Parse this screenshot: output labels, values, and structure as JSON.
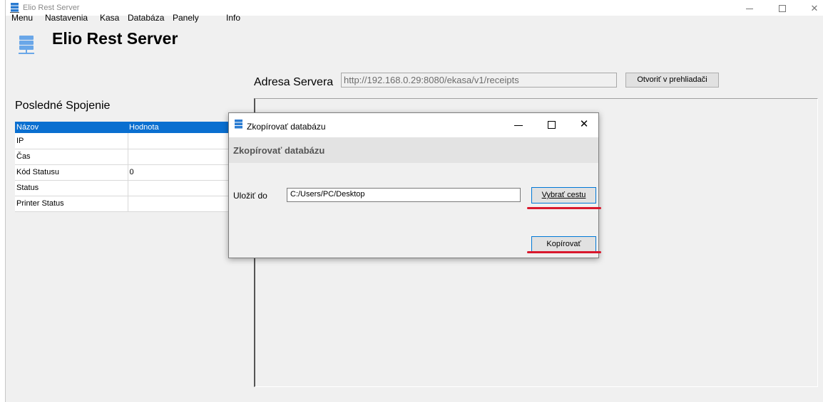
{
  "window": {
    "title": "Elio Rest Server"
  },
  "menu": [
    {
      "label": "Menu"
    },
    {
      "label": "Nastavenia"
    },
    {
      "label": "Kasa"
    },
    {
      "label": "Databáza"
    },
    {
      "label": "Panely"
    },
    {
      "label": "Info"
    }
  ],
  "header": {
    "app_title": "Elio Rest Server"
  },
  "address": {
    "label": "Adresa Servera",
    "value": "http://192.168.0.29:8080/ekasa/v1/receipts",
    "open_button": "Otvoriť v prehliadači"
  },
  "last_connection": {
    "title": "Posledné Spojenie",
    "columns": [
      "Názov",
      "Hodnota"
    ],
    "rows": [
      {
        "name": "IP",
        "value": ""
      },
      {
        "name": "Čas",
        "value": ""
      },
      {
        "name": "Kód Statusu",
        "value": "0"
      },
      {
        "name": "Status",
        "value": ""
      },
      {
        "name": "Printer Status",
        "value": ""
      }
    ]
  },
  "dialog": {
    "title": "Zkopírovať databázu",
    "header": "Zkopírovať databázu",
    "save_label": "Uložiť do",
    "path_value": "C:/Users/PC/Desktop",
    "choose_button": "Vybrať cestu",
    "copy_button": "Kopírovať"
  },
  "colors": {
    "grid_header": "#0a6fd0",
    "highlight_marks": "#d9182d",
    "focus_border": "#0078d7"
  },
  "icons": {
    "app": "server-stack-icon",
    "minimize": "minimize-icon",
    "maximize": "maximize-icon",
    "close": "close-icon"
  }
}
